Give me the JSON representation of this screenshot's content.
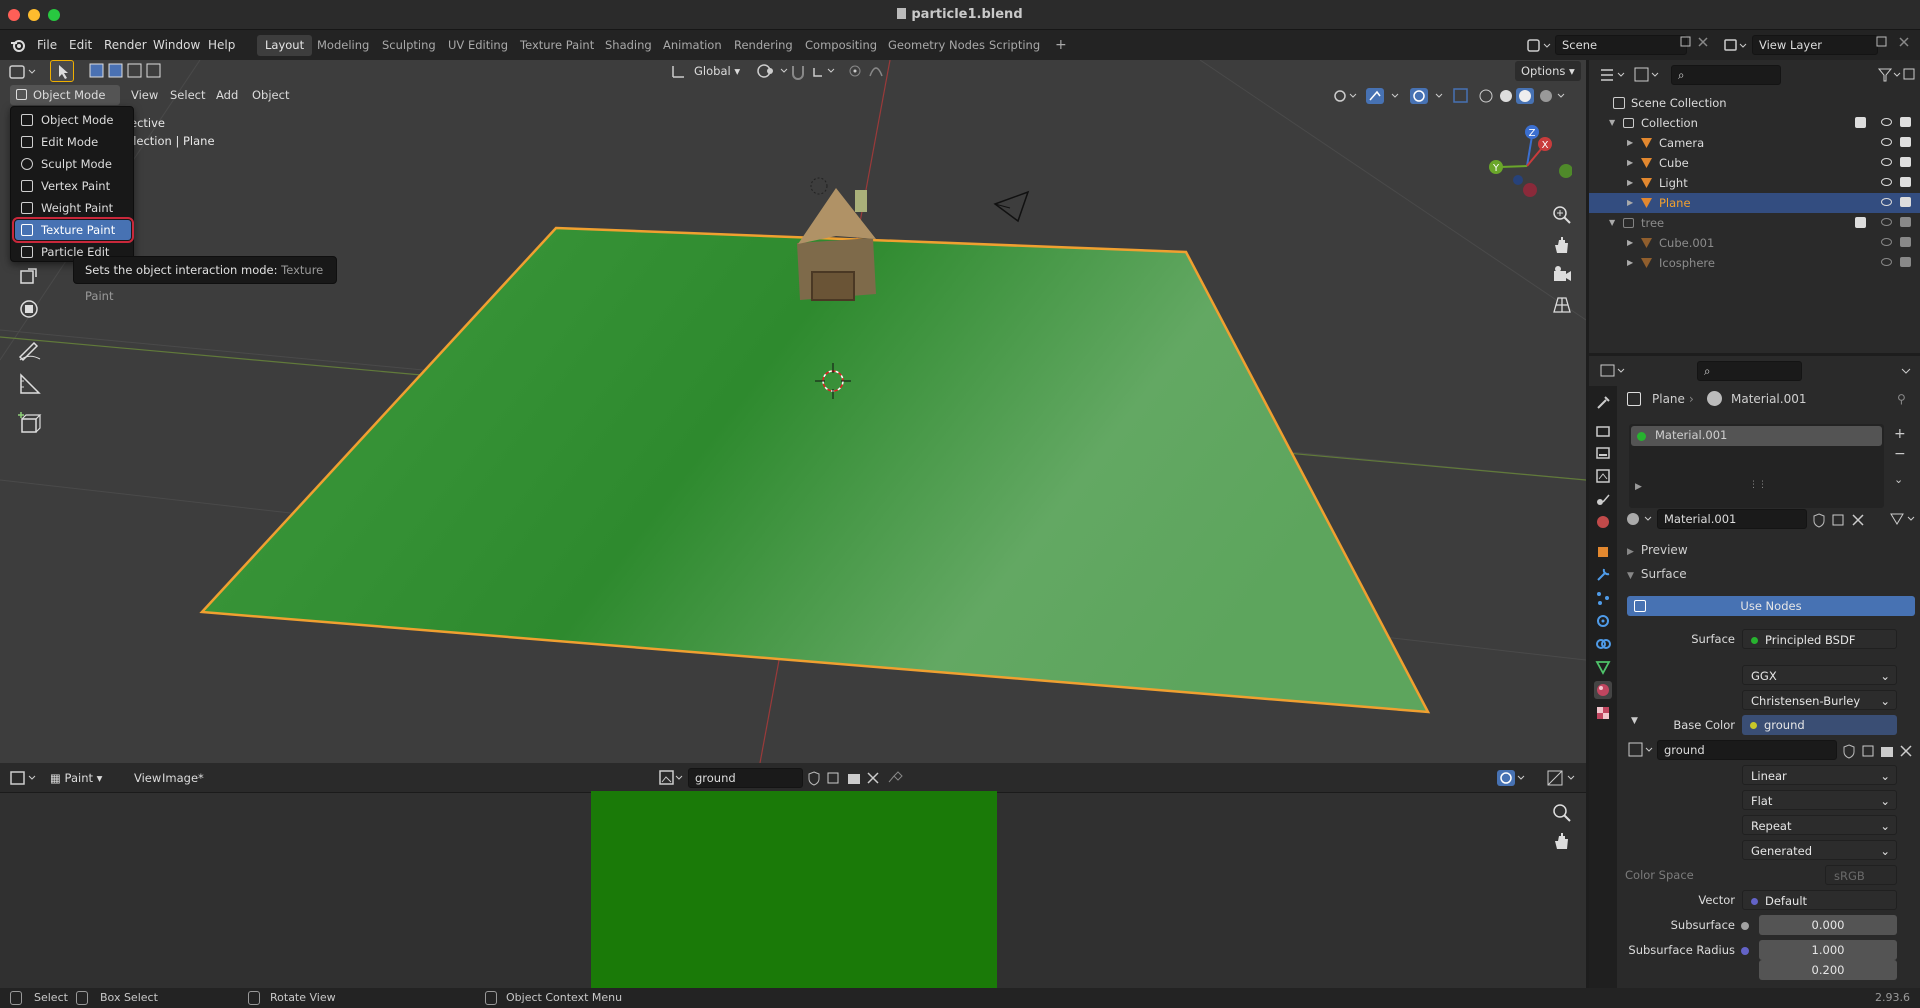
{
  "window": {
    "title": "particle1.blend"
  },
  "menubar": {
    "items": [
      "File",
      "Edit",
      "Render",
      "Window",
      "Help"
    ]
  },
  "workspaces": {
    "tabs": [
      "Layout",
      "Modeling",
      "Sculpting",
      "UV Editing",
      "Texture Paint",
      "Shading",
      "Animation",
      "Rendering",
      "Compositing",
      "Geometry Nodes",
      "Scripting"
    ],
    "active": "Layout",
    "add": "+"
  },
  "scene": {
    "name": "Scene",
    "view_layer": "View Layer"
  },
  "viewport": {
    "transform": "Global",
    "options": "Options",
    "mode_button": "Object Mode",
    "menus": [
      "View",
      "Select",
      "Add",
      "Object"
    ],
    "overlay_text_1": "ective",
    "overlay_text_2": "llection | Plane",
    "gizmo": {
      "z": "Z",
      "y": "Y",
      "x": "X"
    }
  },
  "mode_menu": {
    "items": [
      "Object Mode",
      "Edit Mode",
      "Sculpt Mode",
      "Vertex Paint",
      "Weight Paint",
      "Texture Paint",
      "Particle Edit"
    ],
    "selected": "Texture Paint",
    "tooltip_text": "Sets the object interaction mode:",
    "tooltip_value": "Texture Paint"
  },
  "image_editor": {
    "mode": "Paint",
    "menus": [
      "View",
      "Image*"
    ],
    "image_name": "ground"
  },
  "outliner": {
    "root": "Scene Collection",
    "rows": [
      {
        "label": "Collection",
        "indent": 1
      },
      {
        "label": "Camera",
        "indent": 2
      },
      {
        "label": "Cube",
        "indent": 2
      },
      {
        "label": "Light",
        "indent": 2
      },
      {
        "label": "Plane",
        "indent": 2
      },
      {
        "label": "tree",
        "indent": 1
      },
      {
        "label": "Cube.001",
        "indent": 2
      },
      {
        "label": "Icosphere",
        "indent": 2
      }
    ],
    "selected": "Plane"
  },
  "properties": {
    "object": "Plane",
    "material": "Material.001",
    "slot": "Material.001",
    "material_field": "Material.001",
    "sections": {
      "preview": "Preview",
      "surface": "Surface"
    },
    "use_nodes": "Use Nodes",
    "surface_label": "Surface",
    "surface_value": "Principled BSDF",
    "distribution": "GGX",
    "subsurface_method": "Christensen-Burley",
    "base_color_label": "Base Color",
    "base_color_value": "ground",
    "image_name": "ground",
    "interpolation": "Linear",
    "projection": "Flat",
    "extension": "Repeat",
    "source": "Generated",
    "color_space_label": "Color Space",
    "color_space_value": "sRGB",
    "vector_label": "Vector",
    "vector_value": "Default",
    "subsurface_label": "Subsurface",
    "subsurface_value": "0.000",
    "subsurface_radius_label": "Subsurface Radius",
    "radius_1": "1.000",
    "radius_2": "0.200"
  },
  "statusbar": {
    "select": "Select",
    "box_select": "Box Select",
    "rotate": "Rotate View",
    "context": "Object Context Menu",
    "version": "2.93.6"
  },
  "colors": {
    "accent": "#4772b3",
    "highlight": "#c9283b",
    "ground": "#1a7a08",
    "plane_outline": "#f0a030"
  }
}
